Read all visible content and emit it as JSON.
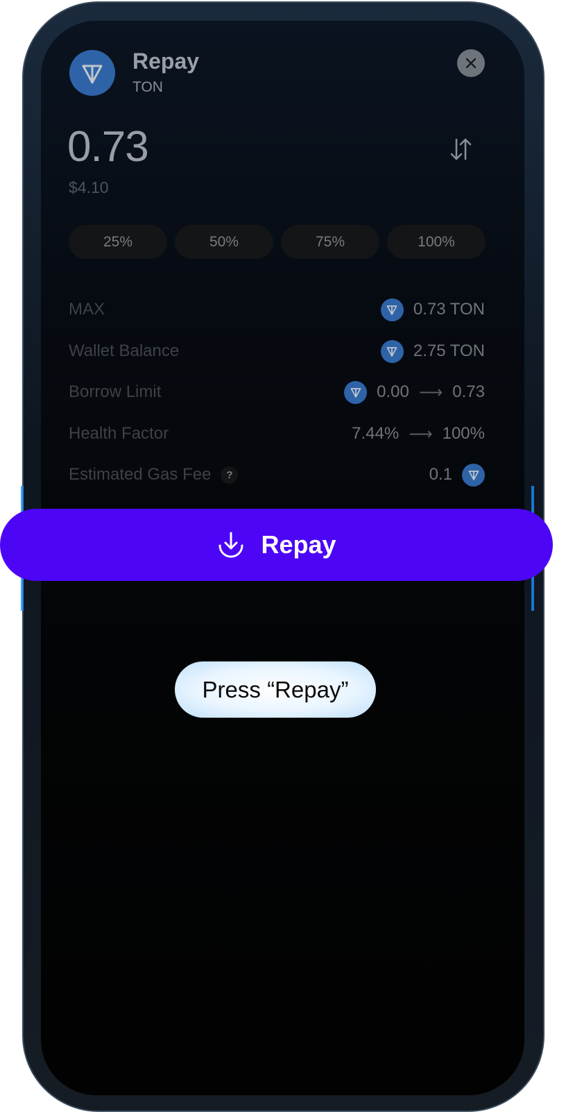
{
  "header": {
    "title": "Repay",
    "asset": "TON"
  },
  "amount": {
    "value": "0.73",
    "usd": "$4.10"
  },
  "percent_buttons": [
    "25%",
    "50%",
    "75%",
    "100%"
  ],
  "details": {
    "max": {
      "label": "MAX",
      "value": "0.73 TON"
    },
    "wallet_balance": {
      "label": "Wallet Balance",
      "value": "2.75 TON"
    },
    "borrow_limit": {
      "label": "Borrow Limit",
      "from": "0.00",
      "to": "0.73"
    },
    "health_factor": {
      "label": "Health Factor",
      "from": "7.44%",
      "to": "100%"
    },
    "gas_fee": {
      "label": "Estimated Gas Fee",
      "help": "?",
      "value": "0.1"
    },
    "arrow": "⟶"
  },
  "action": {
    "label": "Repay"
  },
  "hint": {
    "text": "Press “Repay”"
  },
  "colors": {
    "accent": "#4d06f5",
    "ton_blue": "#2f63a8",
    "hint_bg": "#e9f5ff"
  },
  "icons": {
    "token": "ton-icon",
    "close": "close-icon",
    "swap": "swap-arrows-icon",
    "repay": "download-icon",
    "help": "question-icon"
  }
}
